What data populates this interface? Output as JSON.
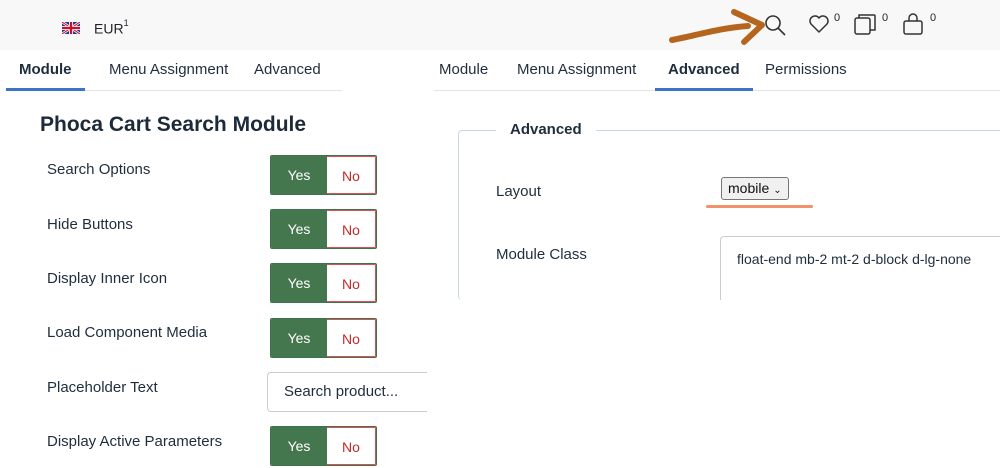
{
  "topbar": {
    "flag_icon": "uk-flag-icon",
    "currency": "EUR",
    "currency_sup": "1",
    "wishlist_count": "0",
    "compare_count": "0",
    "cart_count": "0",
    "arrow_color": "#b5651d"
  },
  "tabs_left": [
    "Module",
    "Menu Assignment",
    "Advanced"
  ],
  "tabs_right": [
    "Module",
    "Menu Assignment",
    "Advanced",
    "Permissions"
  ],
  "module": {
    "title": "Phoca Cart Search Module",
    "fields": [
      {
        "label": "Search Options",
        "yes": "Yes",
        "no": "No"
      },
      {
        "label": "Hide Buttons",
        "yes": "Yes",
        "no": "No"
      },
      {
        "label": "Display Inner Icon",
        "yes": "Yes",
        "no": "No"
      },
      {
        "label": "Load Component Media",
        "yes": "Yes",
        "no": "No"
      },
      {
        "label": "Placeholder Text",
        "value": "Search product..."
      },
      {
        "label": "Display Active Parameters",
        "yes": "Yes",
        "no": "No"
      }
    ]
  },
  "advanced": {
    "legend": "Advanced",
    "layout_label": "Layout",
    "layout_value": "mobile",
    "class_label": "Module Class",
    "class_value": "float-end mb-2 mt-2 d-block d-lg-none"
  },
  "colors": {
    "yes_bg": "#45774f",
    "no_text": "#c52827",
    "active_tab": "#3c74c3",
    "highlight_underline": "#f0926a"
  }
}
